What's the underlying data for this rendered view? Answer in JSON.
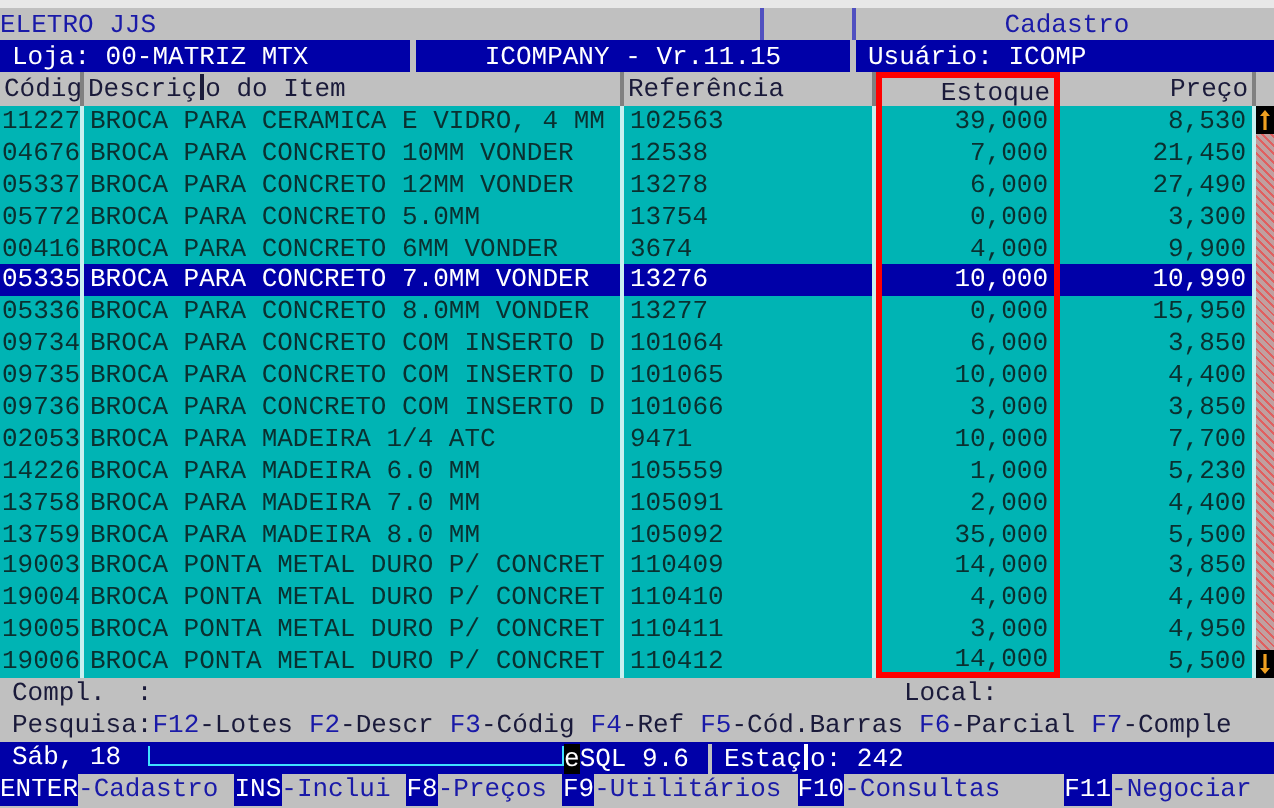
{
  "title_bar": {
    "company": "ELETRO JJS",
    "screen": "Cadastro"
  },
  "info_bar": {
    "store": "Loja: 00-MATRIZ MTX",
    "version": "ICOMPANY - Vr.11.15",
    "user": "Usuário: ICOMP"
  },
  "table": {
    "columns": [
      {
        "label": "Códig",
        "kind": "text",
        "highlighted": false
      },
      {
        "label": "Descriç",
        "label_rest": "o do Item",
        "kind": "text",
        "highlighted": false
      },
      {
        "label": "Referência",
        "kind": "text",
        "highlighted": false
      },
      {
        "label": "Estoque",
        "kind": "number",
        "highlighted": true
      },
      {
        "label": "Preço",
        "kind": "number",
        "highlighted": false
      }
    ],
    "rows": [
      {
        "cells": [
          "11227",
          "BROCA PARA CERAMICA E VIDRO, 4 MM",
          "102563",
          "39,000",
          "8,530"
        ],
        "selected": false
      },
      {
        "cells": [
          "04676",
          "BROCA PARA CONCRETO 10MM VONDER",
          "12538",
          "7,000",
          "21,450"
        ],
        "selected": false
      },
      {
        "cells": [
          "05337",
          "BROCA PARA CONCRETO 12MM VONDER",
          "13278",
          "6,000",
          "27,490"
        ],
        "selected": false
      },
      {
        "cells": [
          "05772",
          "BROCA PARA CONCRETO 5.0MM",
          "13754",
          "0,000",
          "3,300"
        ],
        "selected": false
      },
      {
        "cells": [
          "00416",
          "BROCA PARA CONCRETO 6MM VONDER",
          "3674",
          "4,000",
          "9,900"
        ],
        "selected": false
      },
      {
        "cells": [
          "05335",
          "BROCA PARA CONCRETO 7.0MM VONDER",
          "13276",
          "10,000",
          "10,990"
        ],
        "selected": true
      },
      {
        "cells": [
          "05336",
          "BROCA PARA CONCRETO 8.0MM VONDER",
          "13277",
          "0,000",
          "15,950"
        ],
        "selected": false
      },
      {
        "cells": [
          "09734",
          "BROCA PARA CONCRETO COM INSERTO D",
          "101064",
          "6,000",
          "3,850"
        ],
        "selected": false
      },
      {
        "cells": [
          "09735",
          "BROCA PARA CONCRETO COM INSERTO D",
          "101065",
          "10,000",
          "4,400"
        ],
        "selected": false
      },
      {
        "cells": [
          "09736",
          "BROCA PARA CONCRETO COM INSERTO D",
          "101066",
          "3,000",
          "3,850"
        ],
        "selected": false
      },
      {
        "cells": [
          "02053",
          "BROCA PARA MADEIRA 1/4 ATC",
          "9471",
          "10,000",
          "7,700"
        ],
        "selected": false
      },
      {
        "cells": [
          "14226",
          "BROCA PARA MADEIRA 6.0 MM",
          "105559",
          "1,000",
          "5,230"
        ],
        "selected": false
      },
      {
        "cells": [
          "13758",
          "BROCA PARA MADEIRA 7.0 MM",
          "105091",
          "2,000",
          "4,400"
        ],
        "selected": false
      },
      {
        "cells": [
          "13759",
          "BROCA PARA MADEIRA 8.0 MM",
          "105092",
          "35,000",
          "5,500"
        ],
        "selected": false
      },
      {
        "cells": [
          "19003",
          "BROCA PONTA METAL DURO P/ CONCRET",
          "110409",
          "14,000",
          "3,850"
        ],
        "selected": false
      },
      {
        "cells": [
          "19004",
          "BROCA PONTA METAL DURO P/ CONCRET",
          "110410",
          "4,000",
          "4,400"
        ],
        "selected": false
      },
      {
        "cells": [
          "19005",
          "BROCA PONTA METAL DURO P/ CONCRET",
          "110411",
          "3,000",
          "4,950"
        ],
        "selected": false
      },
      {
        "cells": [
          "19006",
          "BROCA PONTA METAL DURO P/ CONCRET",
          "110412",
          "14,000",
          "5,500"
        ],
        "selected": false
      }
    ]
  },
  "detail_line": {
    "compl": "Compl.  :",
    "local": "Local:"
  },
  "search_line": {
    "prefix": "Pesquisa:",
    "keys": [
      {
        "key": "F12",
        "label": "-Lotes"
      },
      {
        "key": "F2",
        "label": "-Descr"
      },
      {
        "key": "F3",
        "label": "-Códig"
      },
      {
        "key": "F4",
        "label": "-Ref"
      },
      {
        "key": "F5",
        "label": "-Cód.Barras"
      },
      {
        "key": "F6",
        "label": "-Parcial"
      },
      {
        "key": "F7",
        "label": "-Comple"
      }
    ]
  },
  "status_bar": {
    "date": "Sáb, 18",
    "db_mark": "e",
    "db": "SQL 9.6",
    "station": "Estaç",
    "station_rest": "o: 242"
  },
  "function_keys": [
    {
      "key": "ENTER",
      "label": "-Cadastro"
    },
    {
      "key": "INS",
      "label": "-Inclui"
    },
    {
      "key": "F8",
      "label": "-Preços"
    },
    {
      "key": "F9",
      "label": "-Utilitários"
    },
    {
      "key": "F10",
      "label": "-Consultas"
    },
    {
      "key": "F11",
      "label": "-Negociar"
    }
  ]
}
